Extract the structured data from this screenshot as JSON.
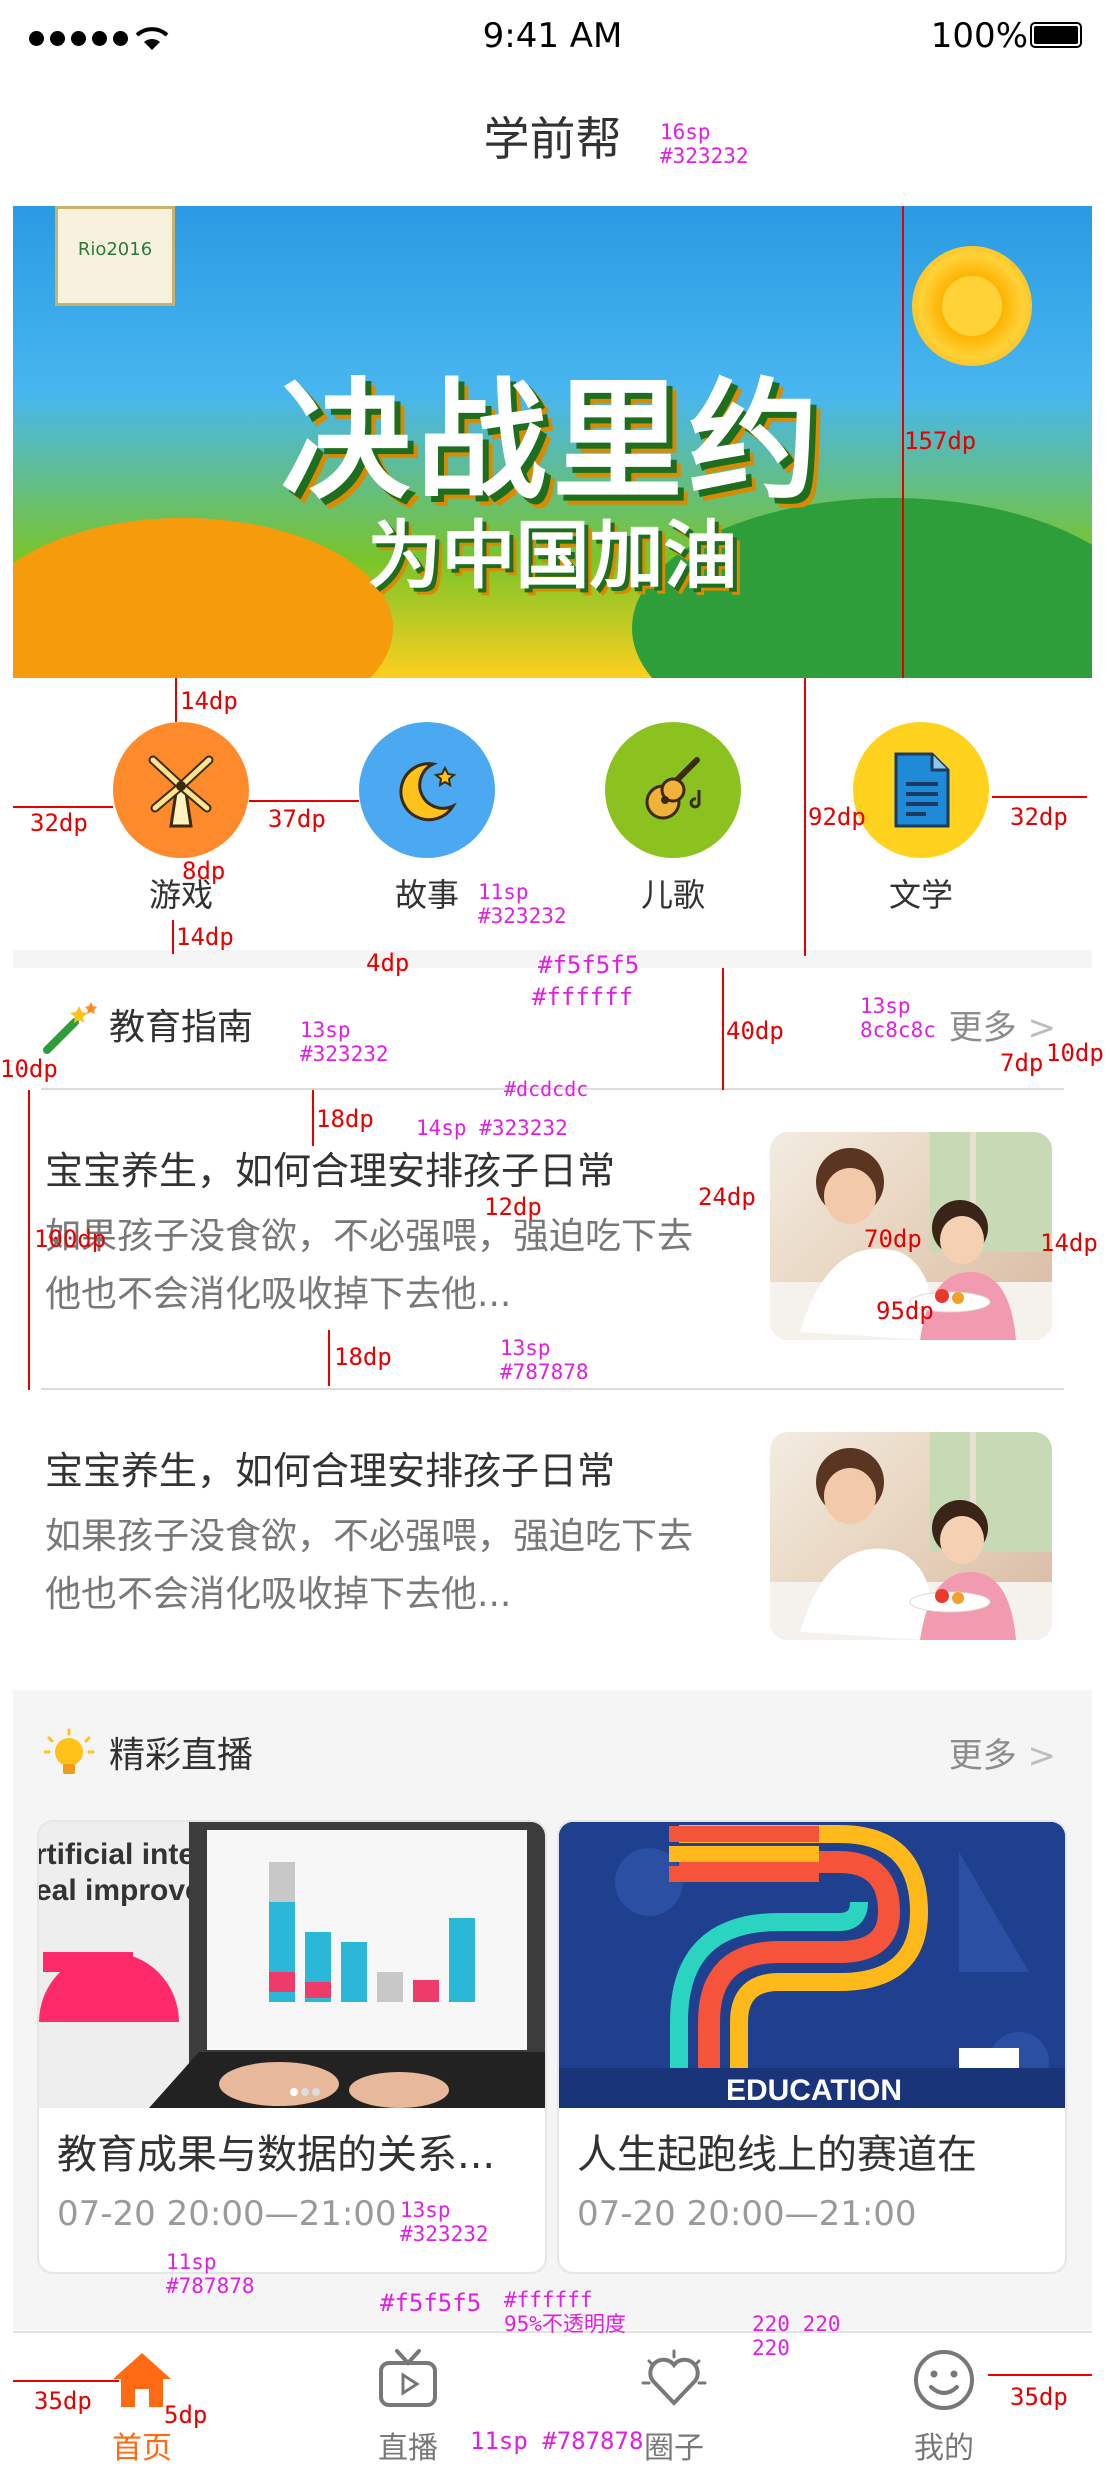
{
  "status_bar": {
    "time": "9:41 AM",
    "battery": "100%"
  },
  "nav": {
    "title": "学前帮"
  },
  "banner": {
    "flag_text": "Rio2016",
    "headline": "决战里约",
    "subline": "为中国加油"
  },
  "categories": [
    {
      "label": "游戏",
      "icon": "windmill-icon",
      "color": "#ff8a2b"
    },
    {
      "label": "故事",
      "icon": "moon-stars-icon",
      "color": "#4aa9f0"
    },
    {
      "label": "儿歌",
      "icon": "guitar-icon",
      "color": "#8bc21f"
    },
    {
      "label": "文学",
      "icon": "document-icon",
      "color": "#ffd21e"
    }
  ],
  "guide": {
    "title": "教育指南",
    "more": "更多",
    "articles": [
      {
        "title": "宝宝养生，如何合理安排孩子日常",
        "desc": "如果孩子没食欲，不必强喂，强迫吃下去他也不会消化吸收掉下去他..."
      },
      {
        "title": "宝宝养生，如何合理安排孩子日常",
        "desc": "如果孩子没食欲，不必强喂，强迫吃下去他也不会消化吸收掉下去他..."
      }
    ]
  },
  "live": {
    "title": "精彩直播",
    "more": "更多",
    "cards": [
      {
        "title": "教育成果与数据的关系...",
        "time": "07-20  20:00—21:00",
        "img_text": "rtificial intelligence\neal improvements"
      },
      {
        "title": "人生起跑线上的赛道在",
        "time": "07-20  20:00—21:00",
        "img_text": "EDUCATION"
      }
    ]
  },
  "tabs": [
    {
      "label": "首页",
      "icon": "home-icon",
      "active": true
    },
    {
      "label": "直播",
      "icon": "tv-icon",
      "active": false
    },
    {
      "label": "圈子",
      "icon": "heart-circle-icon",
      "active": false
    },
    {
      "label": "我的",
      "icon": "smile-icon",
      "active": false
    }
  ],
  "annotations": {
    "nav_font": "16sp",
    "nav_color": "#323232",
    "banner_h": "157dp",
    "cat_top": "14dp",
    "cat_side_l": "32dp",
    "cat_gap": "37dp",
    "cat_block": "92dp",
    "cat_side_r": "32dp",
    "cat_label_gap": "8dp",
    "cat_bottom": "14dp",
    "cat_font": "11sp",
    "cat_color": "#323232",
    "sep_h": "4dp",
    "sep_color": "#f5f5f5",
    "white": "#ffffff",
    "sec_font": "13sp",
    "sec_color": "#323232",
    "sec_h": "40dp",
    "more_font": "13sp",
    "more_color": "8c8c8c",
    "more_gap": "7dp",
    "more_right": "10dp",
    "left_pad": "10dp",
    "divider_color": "#dcdcdc",
    "art_top": "18dp",
    "art_font": "14sp #323232",
    "art_gap": "12dp",
    "art_h": "100dp",
    "thumb_gap": "24dp",
    "thumb_h": "70dp",
    "thumb_w": "95dp",
    "thumb_right": "14dp",
    "desc_font": "13sp",
    "desc_color": "#787878",
    "art_bottom": "18dp",
    "card_font": "13sp",
    "card_color": "#323232",
    "time_font": "11sp",
    "time_color": "#787878",
    "bg_gray": "#f5f5f5",
    "tab_bg": "#ffffff",
    "tab_opacity": "95%不透明度",
    "tab_rgb": "220  220",
    "tab_rgb2": "220",
    "tab_side_l": "35dp",
    "tab_label_gap": "5dp",
    "tab_font": "11sp  #787878",
    "tab_side_r": "35dp"
  }
}
